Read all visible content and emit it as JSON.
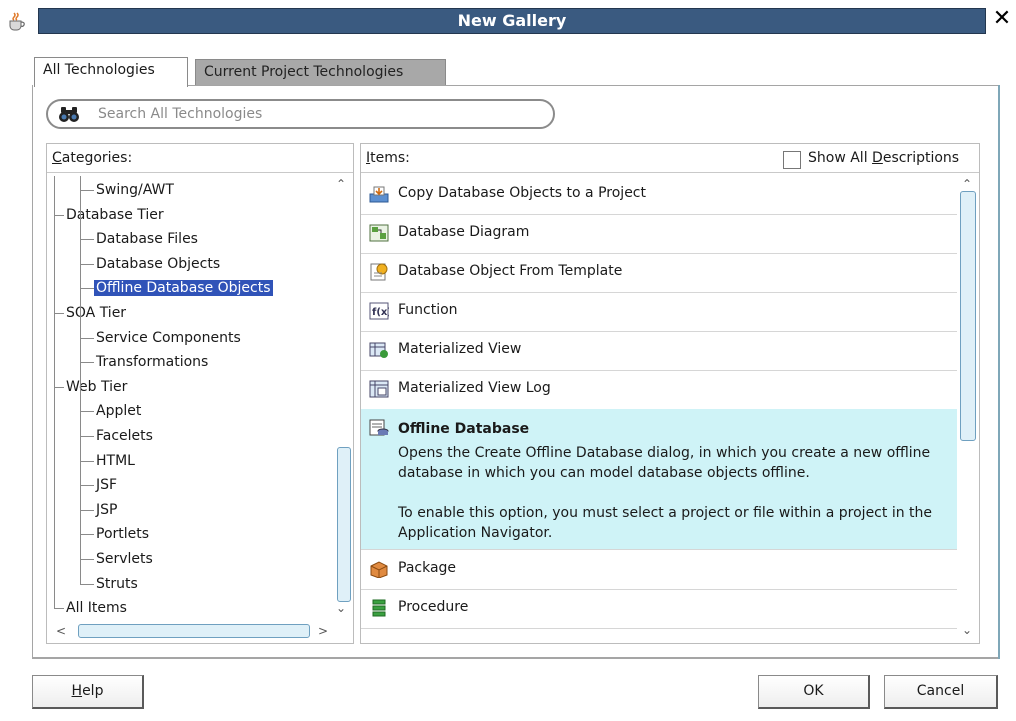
{
  "window": {
    "title": "New Gallery",
    "close_glyph": "✕"
  },
  "tabs": [
    {
      "label": "All Technologies",
      "active": true
    },
    {
      "label": "Current Project Technologies",
      "active": false
    }
  ],
  "search": {
    "placeholder": "Search All Technologies",
    "value": ""
  },
  "categories": {
    "header_prefix": "C",
    "header_rest": "ategories:",
    "items": [
      {
        "label": "Swing/AWT",
        "level": 1
      },
      {
        "label": "Database Tier",
        "level": 0
      },
      {
        "label": "Database Files",
        "level": 1
      },
      {
        "label": "Database Objects",
        "level": 1
      },
      {
        "label": "Offline Database Objects",
        "level": 1,
        "selected": true
      },
      {
        "label": "SOA Tier",
        "level": 0
      },
      {
        "label": "Service Components",
        "level": 1
      },
      {
        "label": "Transformations",
        "level": 1
      },
      {
        "label": "Web Tier",
        "level": 0
      },
      {
        "label": "Applet",
        "level": 1
      },
      {
        "label": "Facelets",
        "level": 1
      },
      {
        "label": "HTML",
        "level": 1
      },
      {
        "label": "JSF",
        "level": 1
      },
      {
        "label": "JSP",
        "level": 1
      },
      {
        "label": "Portlets",
        "level": 1
      },
      {
        "label": "Servlets",
        "level": 1
      },
      {
        "label": "Struts",
        "level": 1
      },
      {
        "label": "All Items",
        "level": 0
      }
    ]
  },
  "items": {
    "header_prefix": "I",
    "header_rest": "tems:",
    "show_all_prefix": "Show All ",
    "show_all_u": "D",
    "show_all_rest": "escriptions",
    "show_all_checked": false,
    "list": [
      {
        "label": "Copy Database Objects to a Project",
        "icon": "copy-db-objects-icon"
      },
      {
        "label": "Database Diagram",
        "icon": "database-diagram-icon"
      },
      {
        "label": "Database Object From Template",
        "icon": "db-object-template-icon"
      },
      {
        "label": "Function",
        "icon": "function-icon"
      },
      {
        "label": "Materialized View",
        "icon": "materialized-view-icon"
      },
      {
        "label": "Materialized View Log",
        "icon": "materialized-view-log-icon"
      },
      {
        "label": "Offline Database",
        "icon": "offline-database-icon",
        "selected": true,
        "description": [
          "Opens the Create Offline Database dialog, in which you create a new offline database in which you can model database objects offline.",
          "To enable this option, you must select a project or file within a project in the Application Navigator."
        ]
      },
      {
        "label": "Package",
        "icon": "package-icon"
      },
      {
        "label": "Procedure",
        "icon": "procedure-icon"
      }
    ]
  },
  "buttons": {
    "help_u": "H",
    "help_rest": "elp",
    "ok": "OK",
    "cancel": "Cancel"
  },
  "colors": {
    "title_bar": "#3a5a80",
    "selection": "#3053b8",
    "selected_item_bg": "#cff3f7"
  }
}
